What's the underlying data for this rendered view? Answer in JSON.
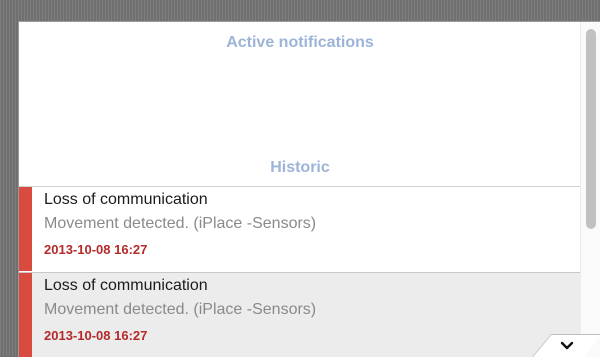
{
  "sections": {
    "active_title": "Active notifications",
    "historic_title": "Historic"
  },
  "notifications": [
    {
      "title": "Loss of communication",
      "description": "Movement detected. (iPlace -Sensors)",
      "date": "2013-10-08 16:27"
    },
    {
      "title": "Loss of communication",
      "description": "Movement detected. (iPlace -Sensors)",
      "date": "2013-10-08 16:27"
    }
  ],
  "colors": {
    "section_title": "#9db4d8",
    "severity_bar": "#d94b3f",
    "date_text": "#b22a2a"
  },
  "icons": {
    "expand": "chevron-down-icon"
  }
}
